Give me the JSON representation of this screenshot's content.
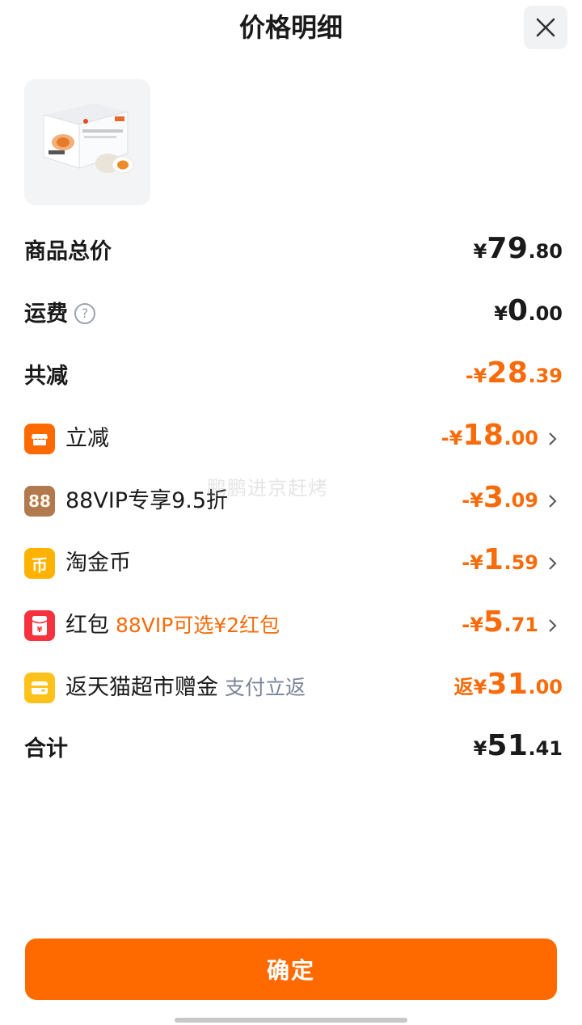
{
  "header": {
    "title": "价格明细"
  },
  "rows": {
    "total_price": {
      "label": "商品总价",
      "prefix": "¥",
      "int": "79",
      "dec": ".80"
    },
    "shipping": {
      "label": "运费",
      "help": "?",
      "prefix": "¥",
      "int": "0",
      "dec": ".00"
    },
    "total_discount": {
      "label": "共减",
      "prefix": "-¥",
      "int": "28",
      "dec": ".39"
    },
    "instant_discount": {
      "label": "立减",
      "prefix": "-¥",
      "int": "18",
      "dec": ".00"
    },
    "vip_discount": {
      "label": "88VIP专享9.5折",
      "icon_text": "88",
      "prefix": "-¥",
      "int": "3",
      "dec": ".09"
    },
    "taojinbi": {
      "label": "淘金币",
      "icon_text": "币",
      "prefix": "-¥",
      "int": "1",
      "dec": ".59"
    },
    "red_packet": {
      "label": "红包",
      "sub": "88VIP可选¥2红包",
      "icon_text": "¥",
      "prefix": "-¥",
      "int": "5",
      "dec": ".71"
    },
    "cashback": {
      "label": "返天猫超市赠金",
      "sub": "支付立返",
      "prefix": "返¥",
      "int": "31",
      "dec": ".00"
    },
    "grand_total": {
      "label": "合计",
      "prefix": "¥",
      "int": "51",
      "dec": ".41"
    }
  },
  "watermark": "鹏鹏进京赶烤",
  "confirm_button": "确定",
  "colors": {
    "accent": "#ff6a00",
    "discount_text": "#f76b0a",
    "gray_text": "#7a8597"
  }
}
